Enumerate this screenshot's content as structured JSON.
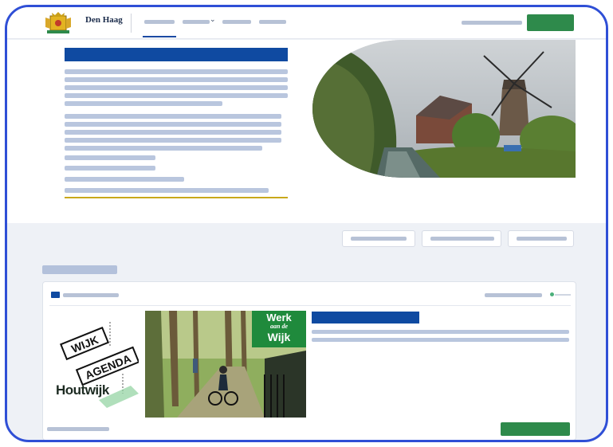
{
  "header": {
    "brand": "Den Haag",
    "logo_icon": "den-haag-coat-of-arms-icon",
    "active_nav_index": 0,
    "accent_color": "#0f4aa1",
    "cta_color": "#2e8a4b"
  },
  "hero": {
    "image": "windmill-canal-photo",
    "rule_color": "#c9a81a"
  },
  "card": {
    "category_icon": "folder-icon",
    "image_left": "wijk-agenda-houtwijk-logo",
    "wijk_word": "WIJK",
    "agenda_word": "AGENDA",
    "houtwijk": "Houtwijk",
    "badge_line1": "Werk",
    "badge_line2": "aan de",
    "badge_line3": "Wijk",
    "photo": "cyclists-park-path-photo"
  }
}
